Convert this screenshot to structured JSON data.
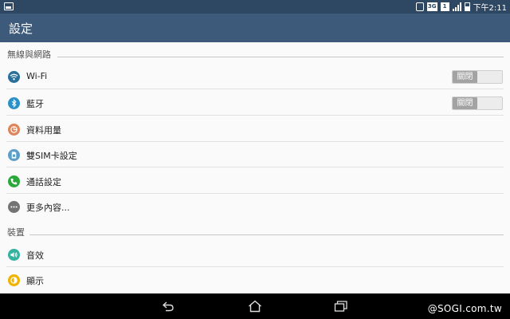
{
  "status_bar": {
    "time": "下午2:11",
    "network_label": "3G",
    "sim_label": "1",
    "icons": [
      "notification-icon",
      "vibrate-icon",
      "network-type-icon",
      "sim-icon",
      "signal-icon",
      "battery-icon"
    ]
  },
  "action_bar": {
    "title": "設定"
  },
  "sections": {
    "wireless": {
      "header": "無線與網路",
      "items": {
        "wifi": {
          "label": "Wi-Fi",
          "icon": "wifi-icon",
          "color": "#2a6f9b",
          "toggle": "關閉"
        },
        "bluetooth": {
          "label": "藍牙",
          "icon": "bluetooth-icon",
          "color": "#2b90c7",
          "toggle": "關閉"
        },
        "data_usage": {
          "label": "資料用量",
          "icon": "data-usage-icon",
          "color": "#e0855a"
        },
        "dual_sim": {
          "label": "雙SIM卡設定",
          "icon": "sim-card-icon",
          "color": "#5a9ec9"
        },
        "call_settings": {
          "label": "通話設定",
          "icon": "phone-icon",
          "color": "#2aa83a"
        },
        "more": {
          "label": "更多內容...",
          "icon": "more-icon",
          "color": "#737373"
        }
      }
    },
    "device": {
      "header": "裝置",
      "items": {
        "sound": {
          "label": "音效",
          "icon": "sound-icon",
          "color": "#35b3a0"
        },
        "display": {
          "label": "顯示",
          "icon": "display-icon",
          "color": "#f0b400"
        }
      }
    }
  },
  "nav_bar": {
    "icons": [
      "back-icon",
      "home-icon",
      "recent-apps-icon"
    ],
    "watermark": "@SOGI.com.tw"
  }
}
